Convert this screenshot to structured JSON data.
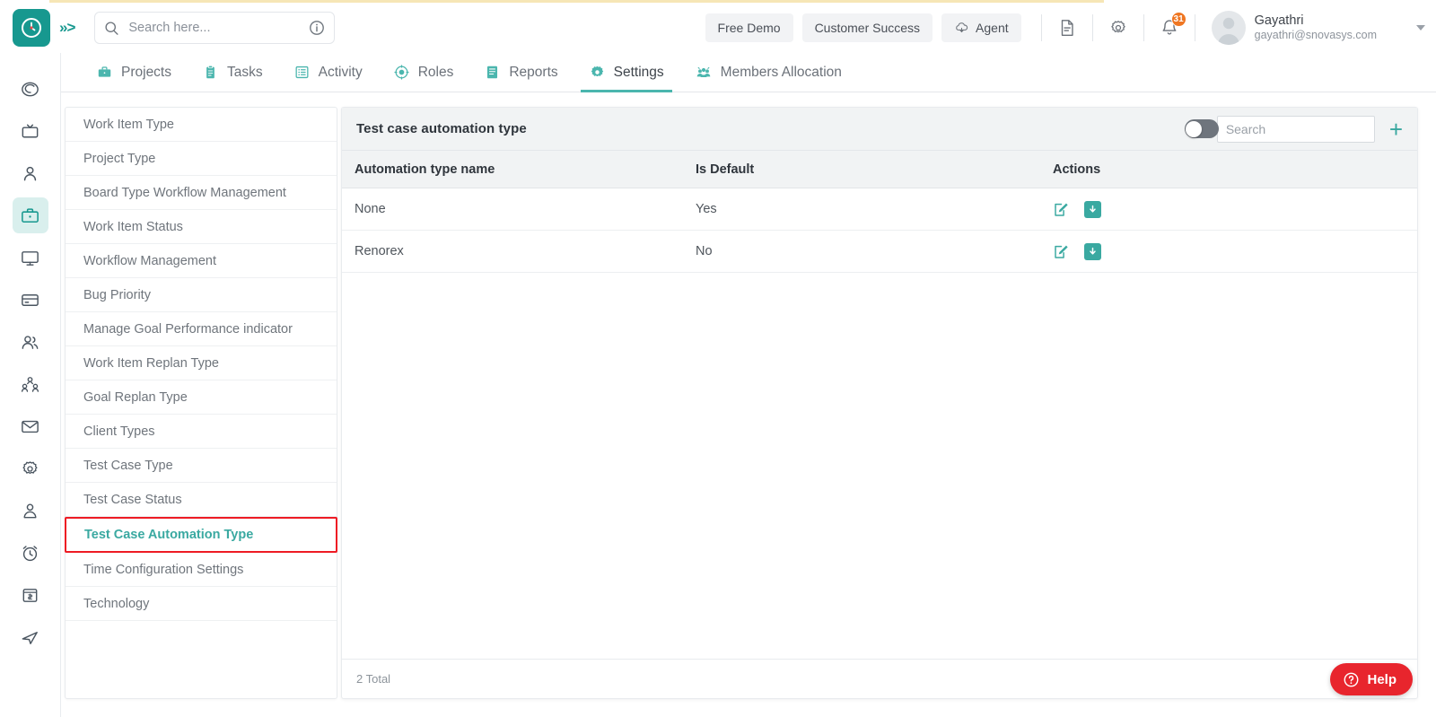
{
  "app": {
    "logo_icon": "clock-logo-icon",
    "expand_icon": "chevron-double-right-icon",
    "accent_color": "#17988f"
  },
  "search": {
    "placeholder": "Search here...",
    "value": "",
    "icon": "search-icon",
    "info_icon": "info-circle-icon"
  },
  "header": {
    "buttons": [
      {
        "label": "Free Demo",
        "icon": ""
      },
      {
        "label": "Customer Success",
        "icon": ""
      },
      {
        "label": "Agent",
        "icon": "cloud-download-icon"
      }
    ],
    "doc_icon": "document-icon",
    "settings_icon": "gear-icon",
    "bell_icon": "bell-icon",
    "notification_count": "31",
    "user": {
      "name": "Gayathri",
      "email": "gayathri@snovasys.com",
      "avatar_icon": "avatar-icon",
      "caret_icon": "chevron-down-icon"
    }
  },
  "rail": {
    "items": [
      {
        "name": "target-spiral-icon",
        "active": false
      },
      {
        "name": "tv-icon",
        "active": false
      },
      {
        "name": "person-icon",
        "active": false
      },
      {
        "name": "briefcase-icon",
        "active": true
      },
      {
        "name": "monitor-icon",
        "active": false
      },
      {
        "name": "card-icon",
        "active": false
      },
      {
        "name": "people-icon",
        "active": false
      },
      {
        "name": "org-chart-icon",
        "active": false
      },
      {
        "name": "envelope-icon",
        "active": false
      },
      {
        "name": "gear-icon",
        "active": false
      },
      {
        "name": "user-tie-icon",
        "active": false
      },
      {
        "name": "alarm-clock-icon",
        "active": false
      },
      {
        "name": "invoice-icon",
        "active": false
      },
      {
        "name": "send-icon",
        "active": false
      }
    ]
  },
  "nav": {
    "tabs": [
      {
        "label": "Projects",
        "icon": "briefcase-icon",
        "active": false
      },
      {
        "label": "Tasks",
        "icon": "clipboard-icon",
        "active": false
      },
      {
        "label": "Activity",
        "icon": "list-icon",
        "active": false
      },
      {
        "label": "Roles",
        "icon": "badge-icon",
        "active": false
      },
      {
        "label": "Reports",
        "icon": "report-icon",
        "active": false
      },
      {
        "label": "Settings",
        "icon": "gear-icon",
        "active": true
      },
      {
        "label": "Members Allocation",
        "icon": "members-icon",
        "active": false
      }
    ]
  },
  "submenu": {
    "items": [
      {
        "label": "Work Item Type",
        "selected": false
      },
      {
        "label": "Project Type",
        "selected": false
      },
      {
        "label": "Board Type Workflow Management",
        "selected": false
      },
      {
        "label": "Work Item Status",
        "selected": false
      },
      {
        "label": "Workflow Management",
        "selected": false
      },
      {
        "label": "Bug Priority",
        "selected": false
      },
      {
        "label": "Manage Goal Performance indicator",
        "selected": false
      },
      {
        "label": "Work Item Replan Type",
        "selected": false
      },
      {
        "label": "Goal Replan Type",
        "selected": false
      },
      {
        "label": "Client Types",
        "selected": false
      },
      {
        "label": "Test Case Type",
        "selected": false
      },
      {
        "label": "Test Case Status",
        "selected": false
      },
      {
        "label": "Test Case Automation Type",
        "selected": true
      },
      {
        "label": "Time Configuration Settings",
        "selected": false
      },
      {
        "label": "Technology",
        "selected": false
      }
    ],
    "highlight_color": "#ee1b24",
    "selected_color": "#3aa9a1"
  },
  "panel": {
    "title": "Test case automation type",
    "toggle_on": false,
    "search_placeholder": "Search",
    "search_value": "",
    "add_label": "+",
    "columns": [
      "Automation type name",
      "Is Default",
      "Actions"
    ],
    "rows": [
      {
        "name": "None",
        "is_default": "Yes",
        "edit_icon": "edit-icon",
        "archive_icon": "archive-download-icon"
      },
      {
        "name": "Renorex",
        "is_default": "No",
        "edit_icon": "edit-icon",
        "archive_icon": "archive-download-icon"
      }
    ],
    "total": "2 Total"
  },
  "help": {
    "label": "Help",
    "icon": "question-circle-icon",
    "color": "#e8252d"
  }
}
